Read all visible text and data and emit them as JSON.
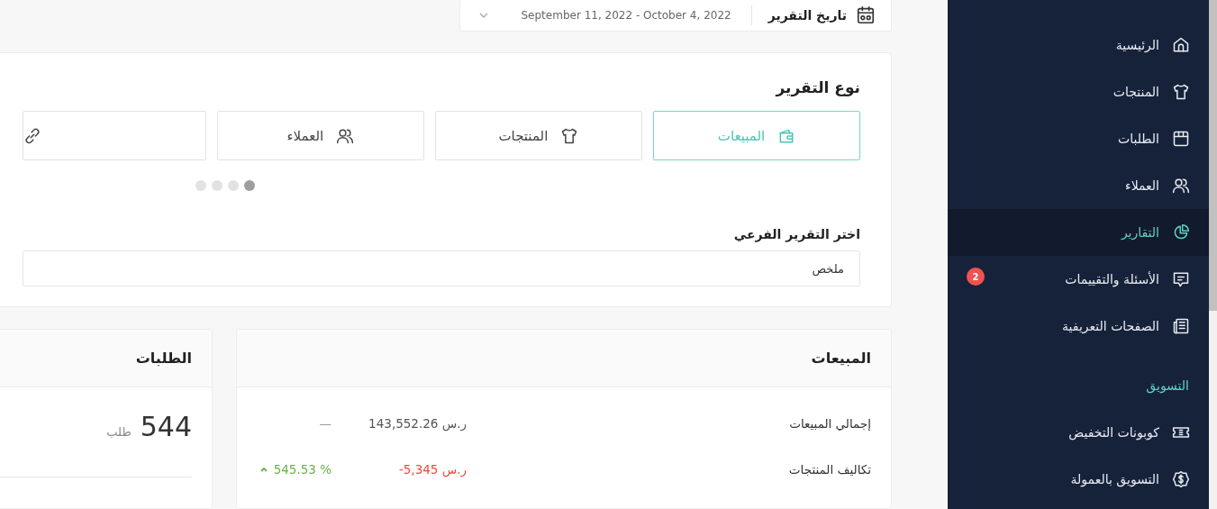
{
  "date_range": {
    "label": "تاريخ التقرير",
    "value": "September 11, 2022 - October 4, 2022"
  },
  "report_type": {
    "title": "نوع التقرير",
    "options": [
      {
        "label": "المبيعات",
        "selected": true
      },
      {
        "label": "المنتجات",
        "selected": false
      },
      {
        "label": "العملاء",
        "selected": false
      },
      {
        "selected": false
      }
    ],
    "pages": [
      {
        "selected": true
      },
      {
        "selected": false
      },
      {
        "selected": false
      },
      {
        "selected": false
      }
    ]
  },
  "sub_report": {
    "label": "اختر التقرير الفرعي",
    "value": "ملخص"
  },
  "sales": {
    "title": "المبيعات",
    "rows": [
      {
        "kind": "flat",
        "label": "إجمالي المبيعات",
        "value": "143,552.26 ر.س",
        "change": "—"
      },
      {
        "kind": "rising",
        "label": "تكاليف المنتجات",
        "value": "-5,345 ر.س",
        "change": "545.53 %"
      }
    ]
  },
  "orders": {
    "title": "الطلبات",
    "count": "544",
    "unit": "طلب"
  },
  "sidebar": {
    "items": [
      {
        "kind": "item",
        "label": "الرئيسية",
        "selected": false
      },
      {
        "kind": "item",
        "label": "المنتجات",
        "selected": false
      },
      {
        "kind": "item",
        "label": "الطلبات",
        "selected": false
      },
      {
        "kind": "item",
        "label": "العملاء",
        "selected": false
      },
      {
        "kind": "item",
        "label": "التقارير",
        "selected": true
      },
      {
        "kind": "item",
        "label": "الأسئلة والتقييمات",
        "selected": false,
        "badge": "2"
      },
      {
        "kind": "item",
        "label": "الصفحات التعريفية",
        "selected": false
      },
      {
        "kind": "heading",
        "label": "التسويق"
      },
      {
        "kind": "item",
        "label": "كوبونات التخفيض",
        "selected": false
      },
      {
        "kind": "item",
        "label": "التسويق بالعمولة",
        "selected": false
      }
    ]
  }
}
